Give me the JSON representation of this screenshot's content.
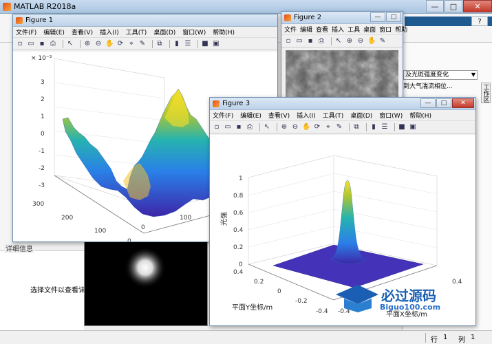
{
  "app": {
    "title": "MATLAB R2018a",
    "window_controls": {
      "minimize": "—",
      "maximize": "□",
      "close": "✕"
    }
  },
  "right_panel": {
    "dropdown": "及光斑强度变化",
    "info": "到大气湍流相位...",
    "side_tab": "工作区"
  },
  "details": {
    "title": "详细信息",
    "hint": "选择文件以查看详细信"
  },
  "status": {
    "row_label": "行",
    "row_value": "1",
    "col_label": "列",
    "col_value": "1"
  },
  "figure1": {
    "title": "Figure 1",
    "menu": [
      "文件(F)",
      "编辑(E)",
      "查看(V)",
      "插入(I)",
      "工具(T)",
      "桌面(D)",
      "窗口(W)",
      "帮助(H)"
    ],
    "exponent": "× 10⁻³",
    "zticks": [
      "3",
      "2",
      "1",
      "0",
      "-1",
      "-2",
      "-3"
    ],
    "yticks": [
      "300",
      "200",
      "100",
      "0"
    ],
    "xticks": [
      "0",
      "100"
    ]
  },
  "figure2": {
    "title": "Figure 2",
    "menu": [
      "文件",
      "编辑",
      "查看",
      "插入",
      "工具",
      "桌面",
      "窗口",
      "帮助"
    ]
  },
  "figure3": {
    "title": "Figure 3",
    "menu": [
      "文件(F)",
      "编辑(E)",
      "查看(V)",
      "插入(I)",
      "工具(T)",
      "桌面(D)",
      "窗口(W)",
      "帮助(H)"
    ],
    "zlabel": "光强",
    "ylabel": "平面Y坐标/m",
    "xlabel": "平面X坐标/m",
    "zticks": [
      "1",
      "0.8",
      "0.6",
      "0.4",
      "0.2",
      "0"
    ],
    "yticks": [
      "0.4",
      "0.2",
      "0",
      "-0.2",
      "-0.4"
    ],
    "xticks": [
      "0.4",
      "-0.4"
    ]
  },
  "watermark": {
    "brand": "必过源码",
    "url": "Biguo100.com"
  },
  "colors": {
    "surface_low": "#3d26a8",
    "surface_mid": "#26b3b0",
    "surface_high": "#f9e02a",
    "titlebar": "#c9dbee",
    "accent": "#1e5a8f"
  }
}
